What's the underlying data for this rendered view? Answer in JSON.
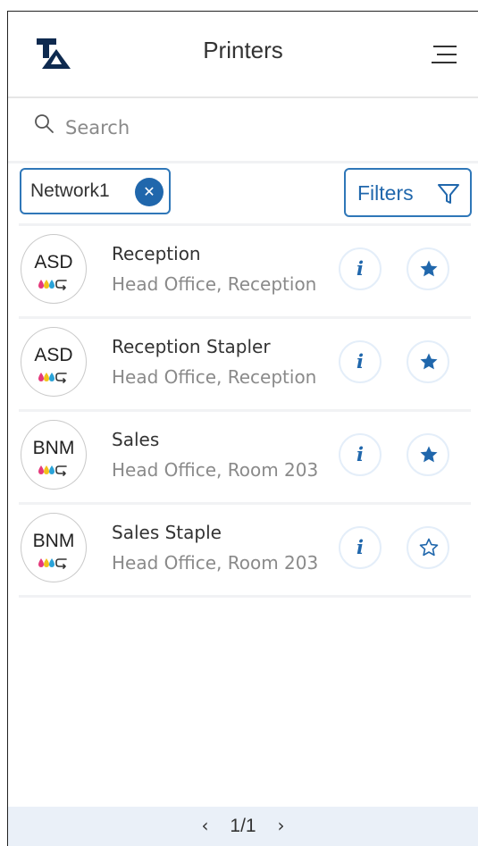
{
  "header": {
    "title": "Printers",
    "logo_text": "TA"
  },
  "search": {
    "placeholder": "Search",
    "value": ""
  },
  "filter_chip": {
    "label": "Network1",
    "remove_symbol": "✕"
  },
  "filters_button": {
    "label": "Filters"
  },
  "colors": {
    "accent": "#2067ac",
    "border": "#2f77b8",
    "footer_bg": "#eaf0f8"
  },
  "printers": [
    {
      "code": "ASD",
      "name": "Reception",
      "location": "Head Office, Reception",
      "favorite": true
    },
    {
      "code": "ASD",
      "name": "Reception Stapler",
      "location": "Head Office, Reception",
      "favorite": true
    },
    {
      "code": "BNM",
      "name": "Sales",
      "location": "Head Office, Room 203",
      "favorite": true
    },
    {
      "code": "BNM",
      "name": "Sales Staple",
      "location": "Head Office, Room 203",
      "favorite": false
    }
  ],
  "info_symbol": "i",
  "pagination": {
    "prev": "‹",
    "label": "1/1",
    "next": "›"
  }
}
